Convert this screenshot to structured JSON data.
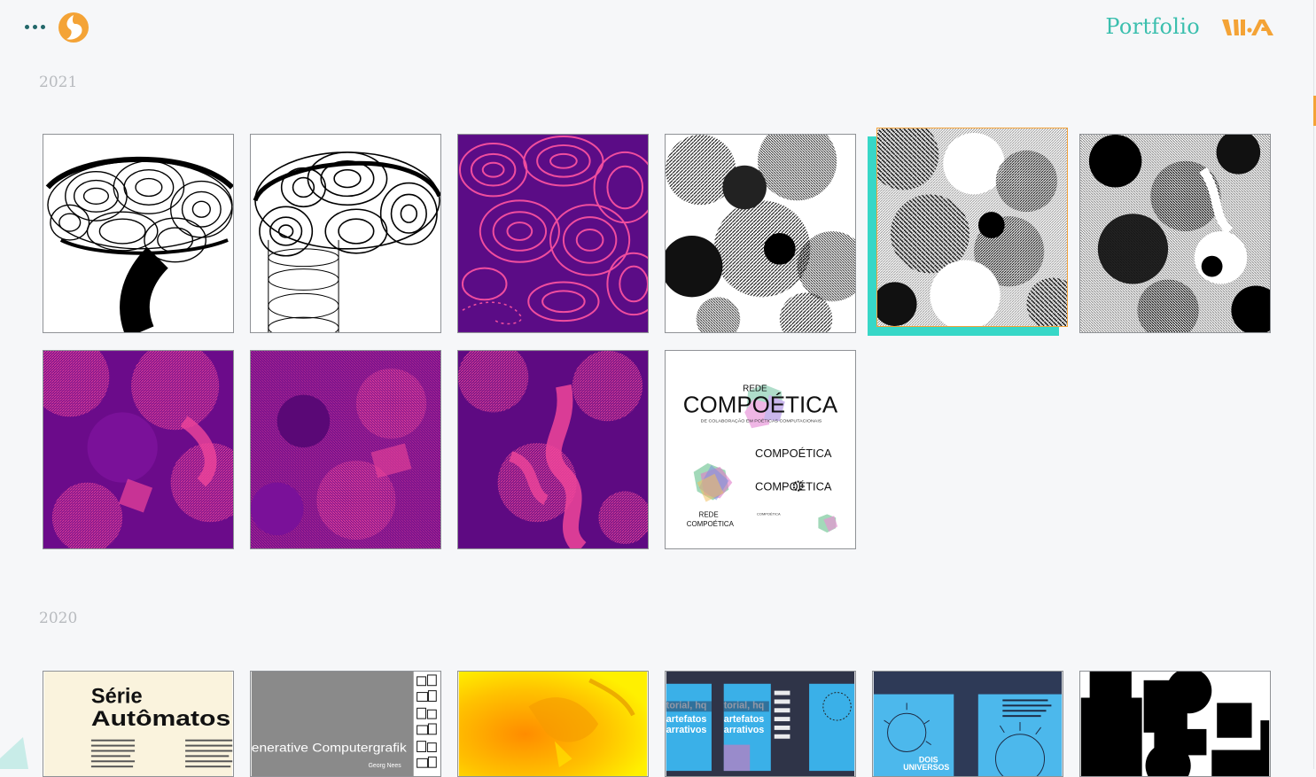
{
  "header": {
    "menu_icon": "more-dots-icon",
    "logo": "round-logo",
    "portfolio_label": "Portfolio",
    "brand_mark": "ylla-logo",
    "accent_color": "#3bbfae",
    "orange": "#f4a336"
  },
  "sections": [
    {
      "year": "2021"
    },
    {
      "year": "2020"
    }
  ],
  "tiles_2021": [
    "spiral-tree-black-on-white",
    "spiral-tree-outline",
    "pink-swirls-on-purple",
    "black-white-texture-1",
    "black-white-texture-2",
    "black-white-texture-3",
    "pink-purple-texture-1",
    "pink-purple-texture-2",
    "pink-purple-texture-3",
    "rede-compoetica-logo-sheet"
  ],
  "compoetica": {
    "rede": "REDE",
    "title": "COMPOÉTICA",
    "subtitle": "DE COLABORAÇÃO EM POÉTICAS COMPUTACIONAIS",
    "mark1": "COMPOÉTICA",
    "mark2": "COMPOÉTICA",
    "small_rede": "REDE",
    "small_name": "COMPOÉTICA",
    "tiny": "COMPOÉTICA"
  },
  "tiles_2020": {
    "serie_line1": "Série",
    "serie_line2": "Autômatos",
    "generative_text": "enerative Computergrafik",
    "generative_author": "Georg Nees",
    "editorial_a": [
      "ucional,",
      "torial, hq",
      "artefatos",
      "arrativos"
    ],
    "editorial_b": [
      "al,",
      "torial, hq",
      "artefatos",
      "arrativos"
    ],
    "dois": "DOIS",
    "universos": "UNIVERSOS"
  }
}
